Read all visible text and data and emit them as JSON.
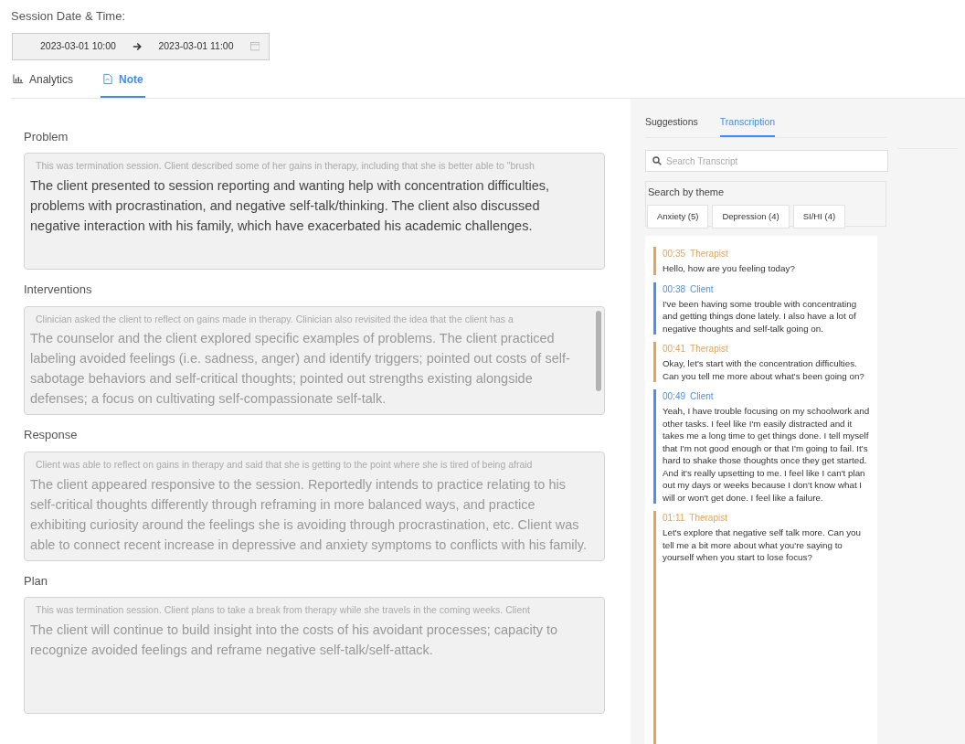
{
  "session": {
    "label": "Session Date & Time:",
    "start": "2023-03-01 10:00",
    "end": "2023-03-01 11:00"
  },
  "tabs": [
    {
      "label": "Analytics",
      "selected": false
    },
    {
      "label": "Note",
      "selected": true
    }
  ],
  "notes": [
    {
      "label": "Problem",
      "hint": "This was termination session. Client described some of her gains in therapy, including that she is better able to \"brush",
      "text": "The client presented to session reporting and wanting help with concentration difficulties, problems with procrastination, and negative self-talk/thinking. The client also discussed negative interaction with his family, which have exacerbated his academic challenges.",
      "dimmed": false,
      "scrollbar": false
    },
    {
      "label": "Interventions",
      "hint": "Clinician asked the client to reflect on gains made in therapy. Clinician also revisited the idea that the client has a",
      "text": "The counselor and the client explored specific examples of problems. The client practiced labeling avoided feelings (i.e. sadness, anger) and identify triggers; pointed out costs of self-sabotage behaviors and self-critical thoughts; pointed out strengths existing alongside defenses; a focus on cultivating self-compassionate self-talk.",
      "dimmed": true,
      "scrollbar": true
    },
    {
      "label": "Response",
      "hint": "Client was able to reflect on gains in therapy and said that she is getting to the point where she is tired of being afraid",
      "text": "The client appeared responsive to the session. Reportedly intends to practice relating to his self-critical thoughts differently through reframing in more balanced ways, and practice exhibiting curiosity around the feelings she is avoiding through procrastination, etc. Client was able to connect recent increase in depressive and anxiety symptoms to conflicts with his family.",
      "dimmed": true,
      "scrollbar": false
    },
    {
      "label": "Plan",
      "hint": "This was termination session. Client plans to take a break from therapy while she travels in the coming weeks. Client",
      "text": "The client will continue to build insight into the costs of his avoidant processes; capacity to recognize avoided feelings and reframe negative self-talk/self-attack.",
      "dimmed": true,
      "scrollbar": false
    }
  ],
  "panel_tabs": [
    {
      "label": "Suggestions",
      "selected": false
    },
    {
      "label": "Transcription",
      "selected": true
    }
  ],
  "search": {
    "placeholder": "Search Transcript"
  },
  "themes": {
    "label": "Search by theme",
    "buttons": [
      "Anxiety (5)",
      "Depression (4)",
      "SI/HI (4)"
    ]
  },
  "transcript": [
    {
      "time": "00:35",
      "speaker": "Therapist",
      "kind": "therapist",
      "text": "Hello, how are you feeling today?"
    },
    {
      "time": "00:38",
      "speaker": "Client",
      "kind": "client",
      "text": "I've been having some trouble with concentrating and getting things done lately. I also have a lot of negative thoughts and self-talk going on."
    },
    {
      "time": "00:41",
      "speaker": "Therapist",
      "kind": "therapist",
      "text": "Okay, let's start with the concentration difficulties. Can you tell me more about what's been going on?"
    },
    {
      "time": "00:49",
      "speaker": "Client",
      "kind": "client",
      "text": "Yeah, I have trouble focusing on my schoolwork and other tasks. I feel like I'm easily distracted and it takes me a long time to get things done. I tell myself that I'm not good enough or that I'm going to fail. It's hard to shake those thoughts once they get started. And it's really upsetting to me. I feel like I can't plan out my days or weeks because I don't know what I will or won't get done. I feel like  a failure."
    },
    {
      "time": "01:11",
      "speaker": "Therapist",
      "kind": "therapist",
      "text": "Let's explore that negative self talk more. Can you tell me a bit more about what you're saying to yourself when you start to lose focus?"
    }
  ]
}
